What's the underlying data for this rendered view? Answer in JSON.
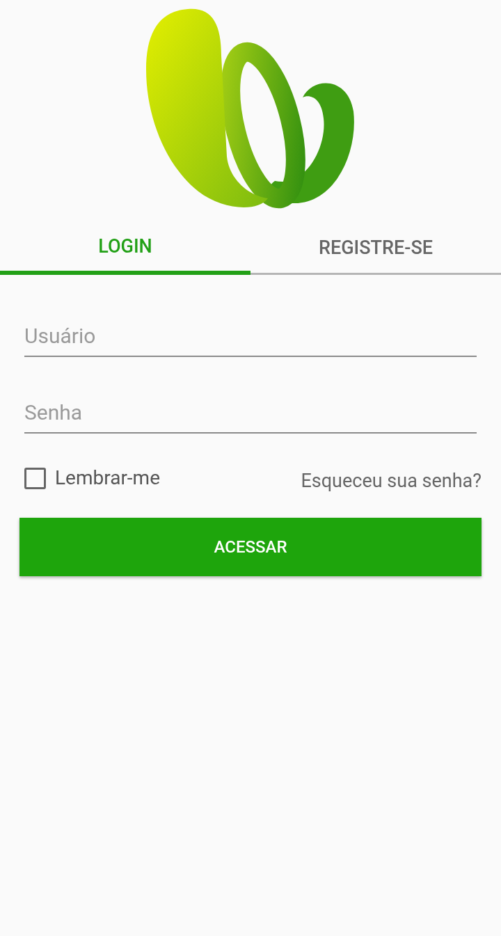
{
  "tabs": [
    {
      "label": "LOGIN",
      "selected": true
    },
    {
      "label": "REGISTRE-SE",
      "selected": false
    }
  ],
  "form": {
    "username": {
      "placeholder": "Usuário"
    },
    "password": {
      "placeholder": "Senha"
    },
    "remember": {
      "label": "Lembrar-me",
      "checked": false
    },
    "forgot_link": "Esqueceu sua senha?",
    "submit": "ACESSAR"
  }
}
